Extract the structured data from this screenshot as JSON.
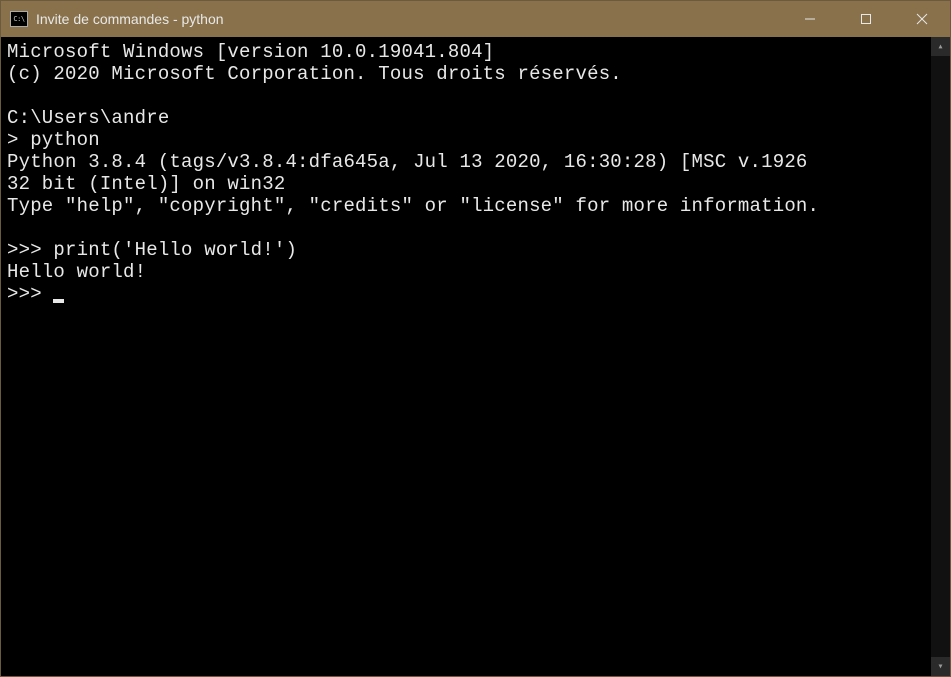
{
  "titlebar": {
    "icon_text": "C:\\",
    "title": "Invite de commandes - python"
  },
  "terminal": {
    "line1": "Microsoft Windows [version 10.0.19041.804]",
    "line2": "(c) 2020 Microsoft Corporation. Tous droits réservés.",
    "blank1": "",
    "line3": "C:\\Users\\andre",
    "line4": "> python",
    "line5": "Python 3.8.4 (tags/v3.8.4:dfa645a, Jul 13 2020, 16:30:28) [MSC v.1926",
    "line6": "32 bit (Intel)] on win32",
    "line7": "Type \"help\", \"copyright\", \"credits\" or \"license\" for more information.",
    "blank2": "",
    "line8": ">>> print('Hello world!')",
    "line9": "Hello world!",
    "line10": ">>> "
  }
}
